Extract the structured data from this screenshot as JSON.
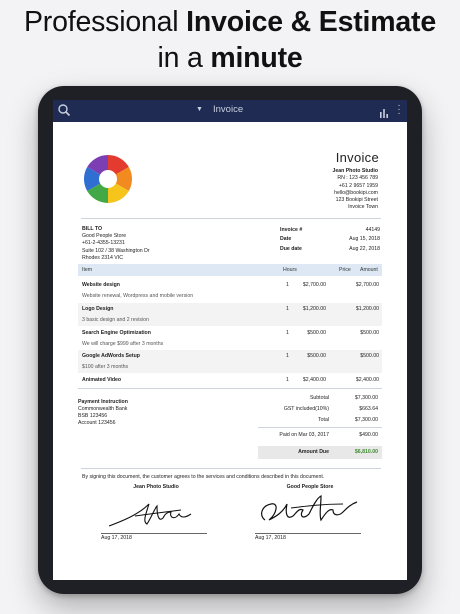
{
  "headline": {
    "line1_normal": "Professional ",
    "line1_bold": "Invoice & Estimate",
    "line2_normal": "in a ",
    "line2_bold": "minute"
  },
  "appbar": {
    "title": "Invoice",
    "icons": [
      "search-icon",
      "chevron-down-icon",
      "bar-chart-icon",
      "more-vert-icon"
    ]
  },
  "invoice": {
    "title": "Invoice",
    "business": {
      "name": "Jean Photo Studio",
      "rn": "RN : 123 456 789",
      "phone": "+61 2 9657 1959",
      "email": "hello@bookipi.com",
      "address1": "123 Bookipi Street",
      "address2": "Invoice Town"
    },
    "bill_to": {
      "label": "BILL TO",
      "name": "Good People Store",
      "phone": "+61-2-4355-13231",
      "address1": "Suite 102 / 38 Washington Dr",
      "address2": "Rhodes 2314 VIC"
    },
    "meta": [
      {
        "label": "Invoice #",
        "value": "44149"
      },
      {
        "label": "Date",
        "value": "Aug 15, 2018"
      },
      {
        "label": "Due date",
        "value": "Aug 22, 2018"
      }
    ],
    "columns": {
      "item": "Item",
      "hours": "Hours",
      "price": "Price",
      "amount": "Amount"
    },
    "items": [
      {
        "name": "Website design",
        "desc": "Website renewal, Wordpress and mobile version",
        "hours": "1",
        "price": "$2,700.00",
        "amount": "$2,700.00"
      },
      {
        "name": "Logo Design",
        "desc": "3 basic design and 2 revision",
        "hours": "1",
        "price": "$1,200.00",
        "amount": "$1,200.00"
      },
      {
        "name": "Search Engine Optimization",
        "desc": "We will charge $999 after 3 months",
        "hours": "1",
        "price": "$500.00",
        "amount": "$500.00"
      },
      {
        "name": "Google AdWords Setup",
        "desc": "$100 after 3 months",
        "hours": "1",
        "price": "$500.00",
        "amount": "$500.00"
      },
      {
        "name": "Animated Video",
        "desc": "",
        "hours": "1",
        "price": "$2,400.00",
        "amount": "$2,400.00"
      }
    ],
    "payment": {
      "label": "Payment Instruction",
      "bank": "Commonwealth Bank",
      "bsb": "BSB 123456",
      "account": "Account 123456"
    },
    "totals": [
      {
        "label": "Subtotal",
        "value": "$7,300.00"
      },
      {
        "label": "GST included(10%)",
        "value": "$663.64"
      },
      {
        "label": "Total",
        "value": "$7,300.00"
      },
      {
        "label": "Paid on Mar 03, 2017",
        "value": "$490.00"
      },
      {
        "label": "Amount Due",
        "value": "$6,810.00"
      }
    ],
    "consent": "By signing this document, the customer agrees to the services and conditions described in this document.",
    "signatures": [
      {
        "name": "Jean Photo Studio",
        "date": "Aug 17, 2018"
      },
      {
        "name": "Good People Store",
        "date": "Aug 17, 2018"
      }
    ]
  },
  "colors": {
    "appbar": "#1f2b52",
    "table_header": "#dde8f4",
    "amount_due": "#3f8a2f",
    "tablet_frame": "#1e2025"
  }
}
